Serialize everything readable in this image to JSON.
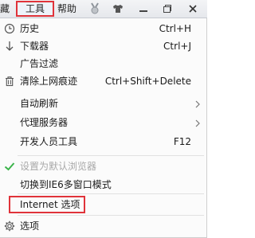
{
  "menubar": {
    "partial_tab": "藏",
    "tools": "工具",
    "help": "帮助"
  },
  "colors": {
    "highlight_border": "#e0333a",
    "checkmark": "#3bb44a",
    "disabled_text": "#a8a8a8"
  },
  "menu": {
    "history": {
      "label": "历史",
      "shortcut": "Ctrl+H",
      "icon": "clock-icon"
    },
    "downloads": {
      "label": "下载器",
      "shortcut": "Ctrl+J",
      "icon": "download-arrow-icon"
    },
    "adfilter": {
      "label": "广告过滤"
    },
    "clear_traces": {
      "label": "清除上网痕迹",
      "shortcut": "Ctrl+Shift+Delete",
      "icon": "trash-icon"
    },
    "auto_refresh": {
      "label": "自动刷新",
      "submenu": true
    },
    "proxy": {
      "label": "代理服务器",
      "submenu": true
    },
    "devtools": {
      "label": "开发人员工具",
      "shortcut": "F12"
    },
    "set_default": {
      "label": "设置为默认浏览器",
      "disabled": true,
      "icon": "check-icon"
    },
    "ie6_mode": {
      "label": "切换到IE6多窗口模式"
    },
    "internet_options": {
      "label": "Internet 选项"
    },
    "options": {
      "label": "选项",
      "icon": "gear-icon"
    }
  }
}
